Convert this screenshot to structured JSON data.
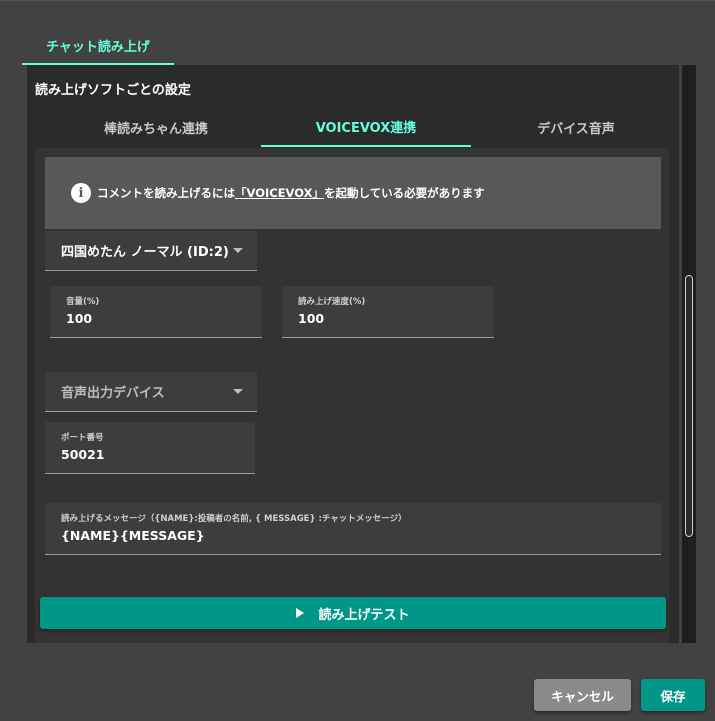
{
  "outer_tab": {
    "label": "チャット読み上げ"
  },
  "section": {
    "title": "読み上げソフトごとの設定"
  },
  "inner_tabs": [
    {
      "label": "棒読みちゃん連携",
      "active": false
    },
    {
      "label": "VOICEVOX連携",
      "active": true
    },
    {
      "label": "デバイス音声",
      "active": false
    }
  ],
  "alert": {
    "icon": "info-icon",
    "text_before": "コメントを読み上げるには",
    "link_text": "「VOICEVOX」",
    "text_after": "を起動している必要があります"
  },
  "voice_select": {
    "value": "四国めたん ノーマル (ID:2)"
  },
  "volume": {
    "label": "音量(%)",
    "value": "100"
  },
  "speed": {
    "label": "読み上げ速度(%)",
    "value": "100"
  },
  "output_device": {
    "placeholder": "音声出力デバイス"
  },
  "port": {
    "label": "ポート番号",
    "value": "50021"
  },
  "message": {
    "label": "読み上げるメッセージ（{NAME}:投稿者の名前, { MESSAGE} :チャットメッセージ）",
    "value": "{NAME}{MESSAGE}"
  },
  "test_button": {
    "label": "読み上げテスト",
    "icon": "play-icon"
  },
  "footer": {
    "cancel_label": "キャンセル",
    "save_label": "保存"
  },
  "colors": {
    "accent": "#64ffda",
    "primary": "#009688",
    "cancel": "#8a8a8a"
  }
}
